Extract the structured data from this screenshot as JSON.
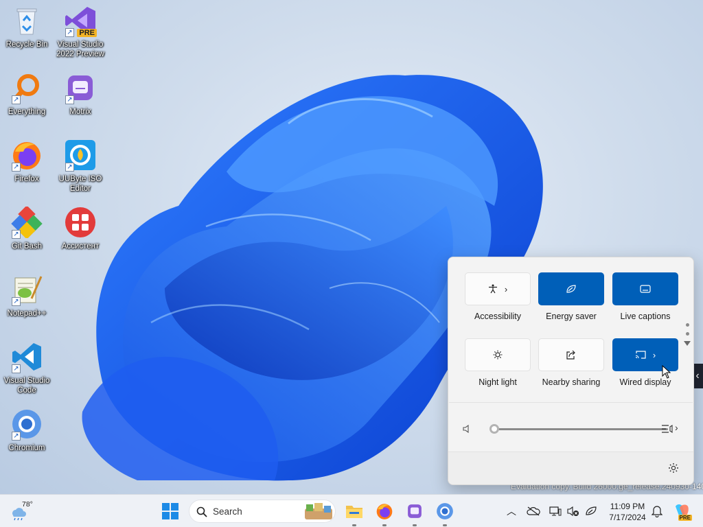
{
  "desktop": {
    "icons": [
      {
        "label": "Recycle Bin",
        "icon": "recycle-bin-icon"
      },
      {
        "label": "Visual Studio\n2022 Preview",
        "icon": "visual-studio-preview-icon",
        "badge": "PRE"
      },
      {
        "label": "Everything",
        "icon": "everything-search-icon"
      },
      {
        "label": "Motrix",
        "icon": "motrix-icon"
      },
      {
        "label": "Firefox",
        "icon": "firefox-icon"
      },
      {
        "label": "UUByte ISO\nEditor",
        "icon": "uubyte-iso-editor-icon"
      },
      {
        "label": "Git Bash",
        "icon": "git-bash-icon"
      },
      {
        "label": "Ассистент",
        "icon": "assistant-icon"
      },
      {
        "label": "Notepad++",
        "icon": "notepad-plus-plus-icon"
      },
      {
        "label": "Visual Studio\nCode",
        "icon": "vscode-icon"
      },
      {
        "label": "Chromium",
        "icon": "chromium-icon"
      }
    ]
  },
  "quick_settings": {
    "tiles": [
      {
        "label": "Accessibility",
        "icon": "accessibility-icon",
        "active": false,
        "has_chevron": true
      },
      {
        "label": "Energy saver",
        "icon": "energy-saver-leaf-icon",
        "active": true,
        "has_chevron": false
      },
      {
        "label": "Live captions",
        "icon": "live-captions-icon",
        "active": true,
        "has_chevron": false
      },
      {
        "label": "Night light",
        "icon": "night-light-sun-icon",
        "active": false,
        "has_chevron": false
      },
      {
        "label": "Nearby sharing",
        "icon": "nearby-sharing-icon",
        "active": false,
        "has_chevron": false
      },
      {
        "label": "Wired display",
        "icon": "wired-display-cast-icon",
        "active": true,
        "has_chevron": true
      }
    ],
    "volume": {
      "icon": "speaker-muted-icon",
      "level": 0
    },
    "accent_color": "#005fb8"
  },
  "watermark": {
    "text": "Evaluation copy. Build 26000.ge_release.240930-1400"
  },
  "taskbar": {
    "weather": {
      "temp": "78°",
      "icon": "weather-rain-cloud-icon"
    },
    "search": {
      "placeholder": "Search"
    },
    "apps": [
      {
        "name": "file-explorer",
        "icon": "folder-icon",
        "running": true
      },
      {
        "name": "firefox",
        "icon": "firefox-icon",
        "running": true
      },
      {
        "name": "motrix",
        "icon": "motrix-icon",
        "running": true
      },
      {
        "name": "chromium",
        "icon": "chromium-icon",
        "running": true
      }
    ],
    "tray": [
      {
        "icon": "chevron-up-icon"
      },
      {
        "icon": "onedrive-cloud-off-icon"
      },
      {
        "icon": "network-display-icon"
      },
      {
        "icon": "volume-muted-icon"
      },
      {
        "icon": "energy-saver-leaf-icon"
      }
    ],
    "clock": {
      "time": "11:09 PM",
      "date": "7/17/2024"
    },
    "notifications_icon": "bell-icon",
    "copilot_badge": "PRE"
  }
}
